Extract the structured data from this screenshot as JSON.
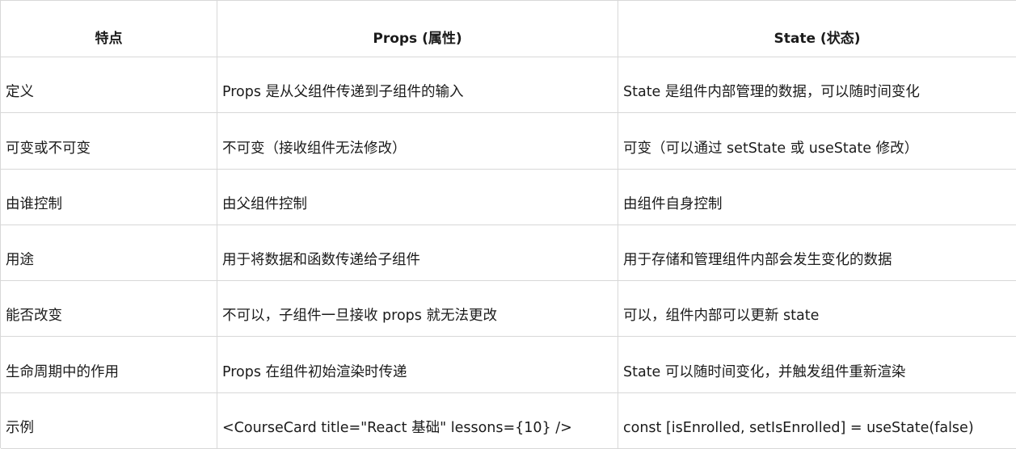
{
  "table": {
    "headers": [
      "特点",
      "Props (属性)",
      "State (状态)"
    ],
    "rows": [
      [
        "定义",
        "Props 是从父组件传递到子组件的输入",
        "State 是组件内部管理的数据，可以随时间变化"
      ],
      [
        "可变或不可变",
        "不可变（接收组件无法修改）",
        "可变（可以通过 setState 或 useState 修改）"
      ],
      [
        "由谁控制",
        "由父组件控制",
        "由组件自身控制"
      ],
      [
        "用途",
        "用于将数据和函数传递给子组件",
        "用于存储和管理组件内部会发生变化的数据"
      ],
      [
        "能否改变",
        "不可以，子组件一旦接收 props 就无法更改",
        "可以，组件内部可以更新 state"
      ],
      [
        "生命周期中的作用",
        "Props 在组件初始渲染时传递",
        "State 可以随时间变化，并触发组件重新渲染"
      ],
      [
        "示例",
        "<CourseCard title=\"React 基础\" lessons={10} />",
        "const [isEnrolled, setIsEnrolled] = useState(false)"
      ]
    ]
  }
}
